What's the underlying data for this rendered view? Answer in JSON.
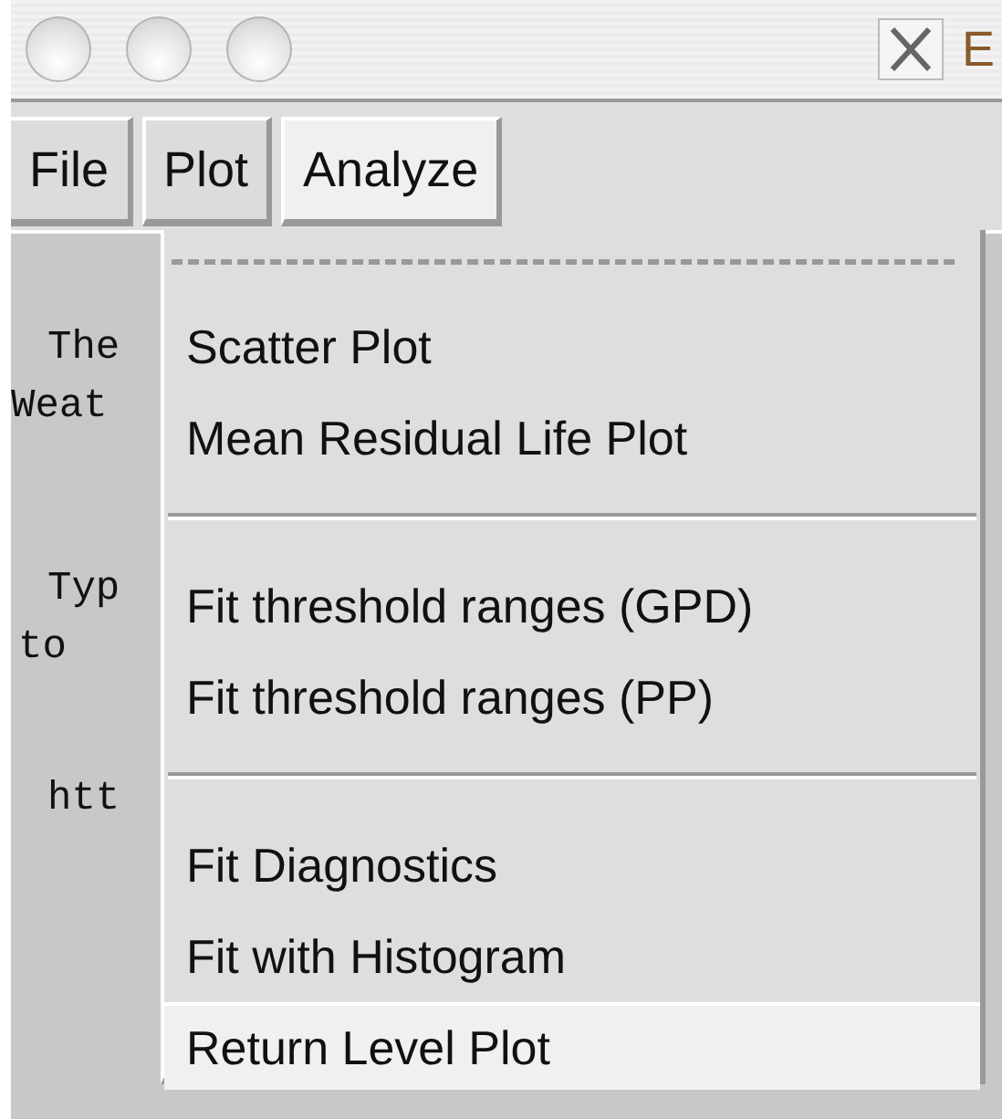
{
  "window": {
    "title": "E"
  },
  "menubar": [
    {
      "label": "File",
      "selected": false
    },
    {
      "label": "Plot",
      "selected": false
    },
    {
      "label": "Analyze",
      "selected": true
    }
  ],
  "background_text": [
    "The",
    "Weat",
    "Typ",
    "to",
    "htt"
  ],
  "menu": {
    "tear_off": true,
    "groups": [
      [
        {
          "label": "Scatter Plot",
          "selected": false
        },
        {
          "label": "Mean Residual Life Plot",
          "selected": false
        }
      ],
      [
        {
          "label": "Fit threshold ranges (GPD)",
          "selected": false
        },
        {
          "label": "Fit threshold ranges (PP)",
          "selected": false
        }
      ],
      [
        {
          "label": "Fit Diagnostics",
          "selected": false
        },
        {
          "label": "Fit with Histogram",
          "selected": false
        },
        {
          "label": "Return Level Plot",
          "selected": true
        }
      ]
    ]
  }
}
